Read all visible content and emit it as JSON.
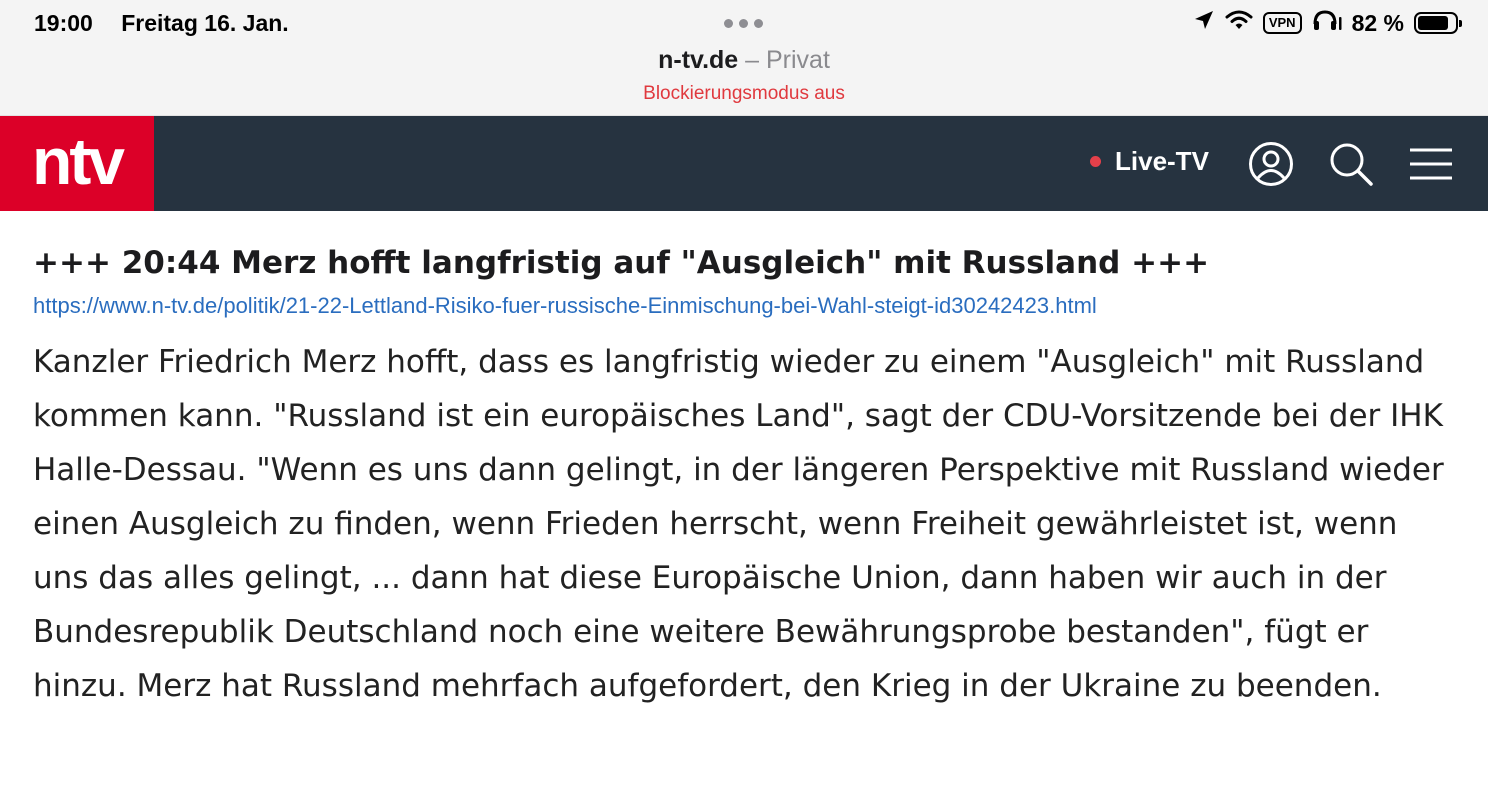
{
  "status_bar": {
    "time": "19:00",
    "date": "Freitag 16. Jan.",
    "vpn": "VPN",
    "battery": "82 %",
    "battery_level": 0.82
  },
  "browser": {
    "domain": "n-tv.de",
    "mode": " – Privat",
    "blocking_status": "Blockierungsmodus aus"
  },
  "site_header": {
    "logo": "ntv",
    "live_label": "Live-TV",
    "icons": [
      "user-icon",
      "search-icon",
      "menu-icon"
    ],
    "colors": {
      "logo_bg": "#dc0028",
      "header_bg": "#263340",
      "live_dot": "#e4404a"
    }
  },
  "article": {
    "headline": "+++ 20:44 Merz hofft langfristig auf \"Ausgleich\" mit Russland +++",
    "url": "https://www.n-tv.de/politik/21-22-Lettland-Risiko-fuer-russische-Einmischung-bei-Wahl-steigt-id30242423.html",
    "body": "Kanzler Friedrich Merz hofft, dass es langfristig wieder zu einem \"Ausgleich\" mit Russland kommen kann. \"Russland ist ein europäisches Land\", sagt der CDU-Vorsitzende bei der IHK Halle-Dessau. \"Wenn es uns dann gelingt, in der längeren Perspektive mit Russland wieder einen Ausgleich zu finden, wenn Frieden herrscht, wenn Freiheit gewährleistet ist, wenn uns das alles gelingt, ... dann hat diese Europäische Union, dann haben wir auch in der Bundesrepublik Deutschland noch eine weitere Bewährungsprobe bestanden\", fügt er hinzu. Merz hat Russland mehrfach aufgefordert, den Krieg in der Ukraine zu beenden."
  }
}
